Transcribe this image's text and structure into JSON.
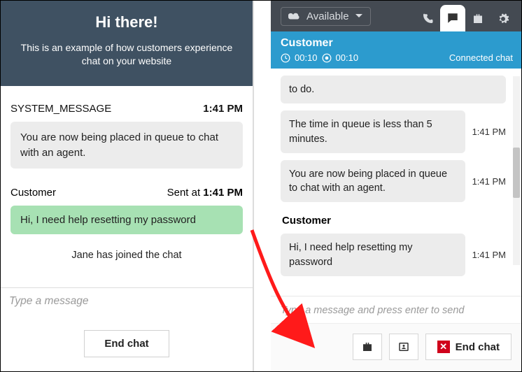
{
  "left": {
    "banner_title": "Hi there!",
    "banner_text": "This is an example of how customers experience chat on your website",
    "system_label": "SYSTEM_MESSAGE",
    "system_time": "1:41 PM",
    "system_body": "You are now being placed in queue to chat with an agent.",
    "customer_label": "Customer",
    "customer_sent_prefix": "Sent at ",
    "customer_sent_time": "1:41 PM",
    "customer_msg": "Hi, I need help resetting my password",
    "joined_text": "Jane has joined the chat",
    "input_placeholder": "Type a message",
    "end_chat_label": "End chat"
  },
  "right": {
    "status_label": "Available",
    "customer_name": "Customer",
    "timer1": "00:10",
    "timer2": "00:10",
    "connected_label": "Connected chat",
    "messages": {
      "m0": {
        "body": "to do.",
        "time": ""
      },
      "m1": {
        "body": "The time in queue is less than 5 minutes.",
        "time": "1:41 PM"
      },
      "m2": {
        "body": "You are now being placed in queue to chat with an agent.",
        "time": "1:41 PM"
      },
      "m3_header": "Customer",
      "m3": {
        "body": "Hi, I need help resetting my password",
        "time": "1:41 PM"
      }
    },
    "input_placeholder": "Type a message and press enter to send",
    "end_chat_label": "End chat"
  }
}
